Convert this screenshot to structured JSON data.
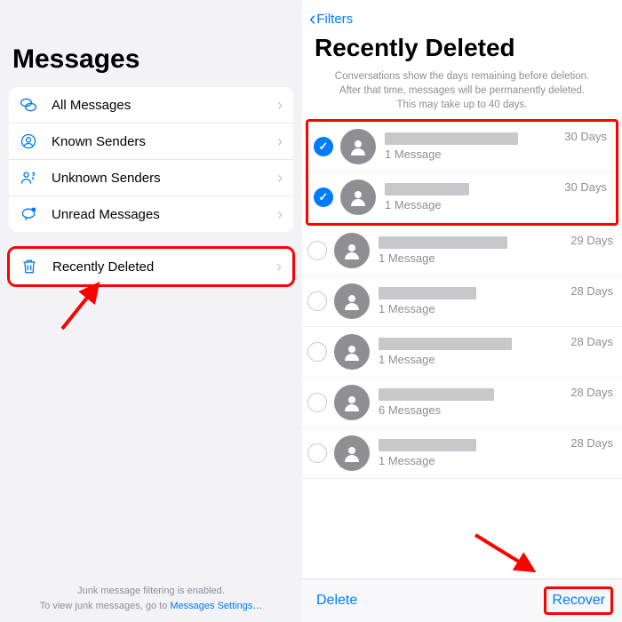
{
  "left": {
    "title": "Messages",
    "filters": [
      {
        "label": "All Messages",
        "icon": "chat-bubbles-icon"
      },
      {
        "label": "Known Senders",
        "icon": "person-circle-icon"
      },
      {
        "label": "Unknown Senders",
        "icon": "person-question-icon"
      },
      {
        "label": "Unread Messages",
        "icon": "unread-bubble-icon"
      }
    ],
    "recently_deleted": {
      "label": "Recently Deleted",
      "icon": "trash-icon"
    },
    "junk_line1": "Junk message filtering is enabled.",
    "junk_line2_prefix": "To view junk messages, go to ",
    "junk_link": "Messages Settings…"
  },
  "right": {
    "back_label": "Filters",
    "title": "Recently Deleted",
    "info_line1": "Conversations show the days remaining before deletion.",
    "info_line2": "After that time, messages will be permanently deleted.",
    "info_line3": "This may take up to 40 days.",
    "conversations": [
      {
        "selected": true,
        "name_width": 150,
        "sub": "1 Message",
        "days": "30 Days"
      },
      {
        "selected": true,
        "name_width": 95,
        "sub": "1 Message",
        "days": "30 Days"
      },
      {
        "selected": false,
        "name_width": 145,
        "sub": "1 Message",
        "days": "29 Days"
      },
      {
        "selected": false,
        "name_width": 110,
        "sub": "1 Message",
        "days": "28 Days"
      },
      {
        "selected": false,
        "name_width": 150,
        "sub": "1 Message",
        "days": "28 Days"
      },
      {
        "selected": false,
        "name_width": 130,
        "sub": "6 Messages",
        "days": "28 Days"
      },
      {
        "selected": false,
        "name_width": 110,
        "sub": "1 Message",
        "days": "28 Days"
      }
    ],
    "delete_label": "Delete",
    "recover_label": "Recover"
  }
}
